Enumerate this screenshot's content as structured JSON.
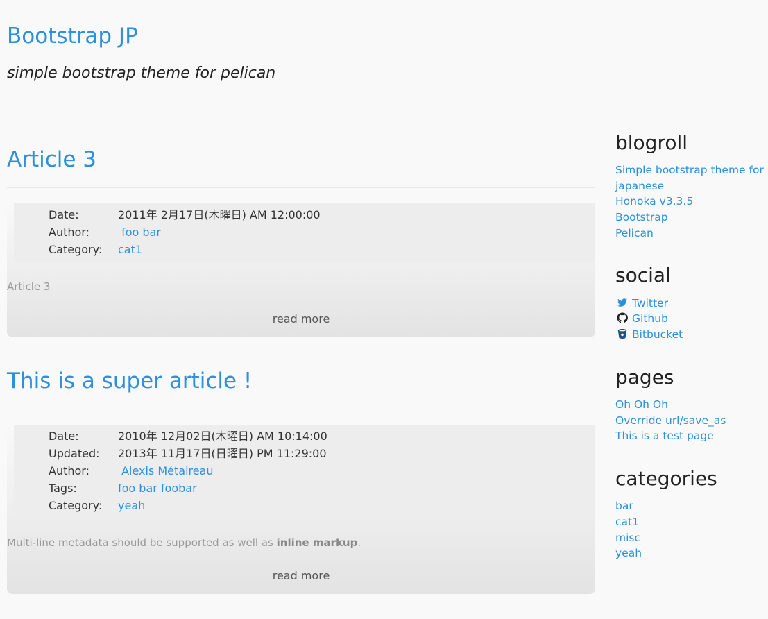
{
  "site": {
    "title": "Bootstrap JP",
    "subtitle": "simple bootstrap theme for pelican"
  },
  "articles": [
    {
      "title": "Article 3",
      "meta": [
        {
          "key": "Date:",
          "value": "2011年 2月17日(木曜日) AM 12:00:00",
          "link": false
        },
        {
          "key": "Author:",
          "value": " foo bar",
          "link": true
        },
        {
          "key": "Category:",
          "value": "cat1",
          "link": true
        }
      ],
      "summary": "Article 3",
      "read_more": "read more"
    },
    {
      "title": "This is a super article !",
      "meta": [
        {
          "key": "Date:",
          "value": "2010年 12月02日(木曜日) AM 10:14:00",
          "link": false
        },
        {
          "key": "Updated:",
          "value": "2013年 11月17日(日曜日) PM 11:29:00",
          "link": false
        },
        {
          "key": "Author:",
          "value": " Alexis Métaireau",
          "link": true
        },
        {
          "key": "Tags:",
          "value": "foo bar foobar",
          "link": true
        },
        {
          "key": "Category:",
          "value": "yeah",
          "link": true
        }
      ],
      "summary_prefix": "Multi-line metadata should be supported as well as ",
      "summary_bold": "inline markup",
      "summary_suffix": ".",
      "read_more": "read more"
    }
  ],
  "sidebar": {
    "blogroll": {
      "heading": "blogroll",
      "links": [
        "Simple bootstrap theme for",
        "japanese",
        "Honoka v3.3.5",
        "Bootstrap",
        "Pelican"
      ]
    },
    "social": {
      "heading": "social",
      "links": [
        {
          "label": "Twitter",
          "icon": "twitter-icon"
        },
        {
          "label": "Github",
          "icon": "github-icon"
        },
        {
          "label": "Bitbucket",
          "icon": "bitbucket-icon"
        }
      ]
    },
    "pages": {
      "heading": "pages",
      "links": [
        "Oh Oh Oh",
        "Override url/save_as",
        "This is a test page"
      ]
    },
    "categories": {
      "heading": "categories",
      "links": [
        "bar",
        "cat1",
        "misc",
        "yeah"
      ]
    }
  },
  "colors": {
    "link": "#2d8fdd",
    "background": "#f9f9f9",
    "meta_bg": "#ededed"
  }
}
